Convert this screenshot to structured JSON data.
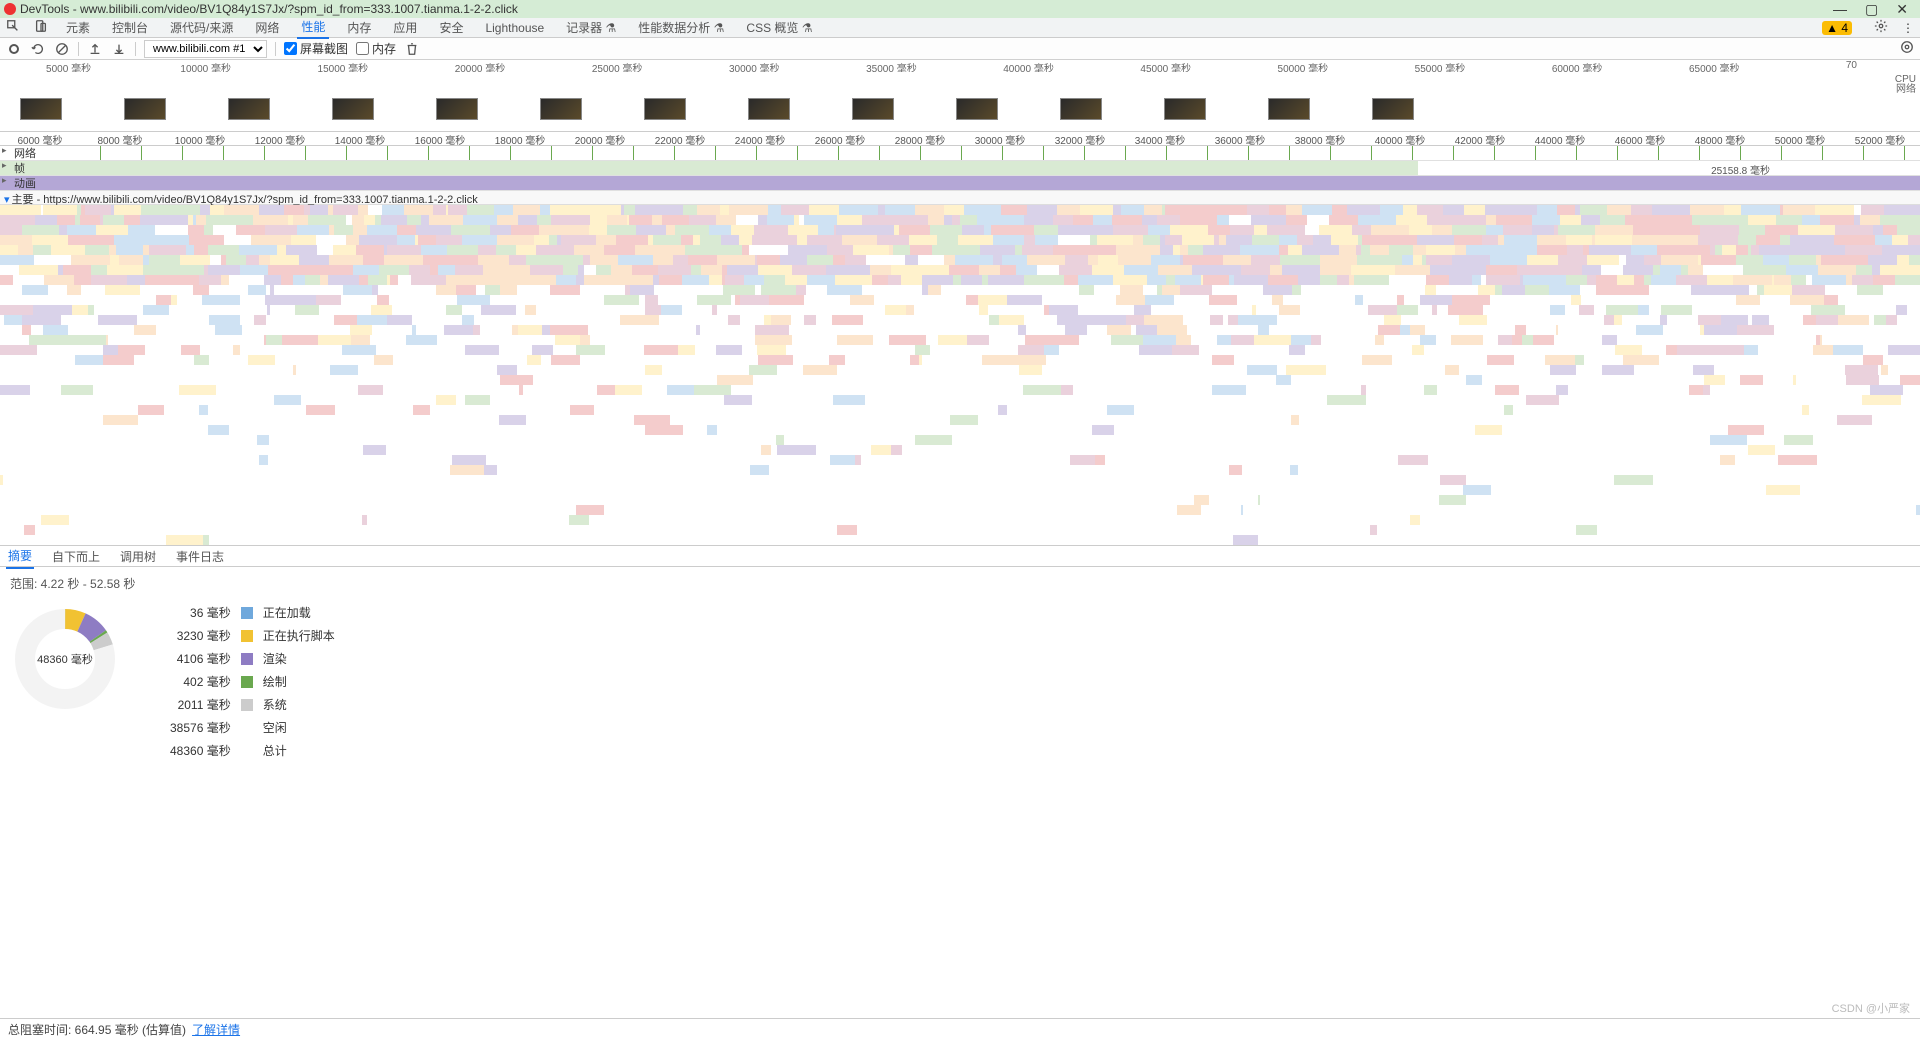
{
  "window": {
    "title": "DevTools - www.bilibili.com/video/BV1Q84y1S7Jx/?spm_id_from=333.1007.tianma.1-2-2.click"
  },
  "tabs": {
    "items": [
      "元素",
      "控制台",
      "源代码/来源",
      "网络",
      "性能",
      "内存",
      "应用",
      "安全",
      "Lighthouse",
      "记录器",
      "性能数据分析",
      "CSS 概览"
    ],
    "active_index": 4,
    "preview_badges": [
      "⚗",
      "⚗",
      "⚗"
    ],
    "warning_count": "4"
  },
  "toolbar": {
    "target": "www.bilibili.com #1",
    "screenshot_label": "屏幕截图",
    "memory_label": "内存",
    "screenshot_checked": true,
    "memory_checked": false
  },
  "overview": {
    "ticks": [
      "5000 毫秒",
      "10000 毫秒",
      "15000 毫秒",
      "20000 毫秒",
      "25000 毫秒",
      "30000 毫秒",
      "35000 毫秒",
      "40000 毫秒",
      "45000 毫秒",
      "50000 毫秒",
      "55000 毫秒",
      "60000 毫秒",
      "65000 毫秒",
      "70"
    ],
    "cpu": "CPU",
    "net": "网络"
  },
  "filmstrip_ticks": [
    "6000 毫秒",
    "8000 毫秒",
    "10000 毫秒",
    "12000 毫秒",
    "14000 毫秒",
    "16000 毫秒",
    "18000 毫秒",
    "20000 毫秒",
    "22000 毫秒",
    "24000 毫秒",
    "26000 毫秒",
    "28000 毫秒",
    "30000 毫秒",
    "32000 毫秒",
    "34000 毫秒",
    "36000 毫秒",
    "38000 毫秒",
    "40000 毫秒",
    "42000 毫秒",
    "44000 毫秒",
    "46000 毫秒",
    "48000 毫秒",
    "50000 毫秒",
    "52000 毫秒"
  ],
  "tracks": {
    "network": "网络",
    "frames": "帧",
    "frames_marker": "25158.8 毫秒",
    "animation": "动画",
    "main": "主要 - https://www.bilibili.com/video/BV1Q84y1S7Jx/?spm_id_from=333.1007.tianma.1-2-2.click"
  },
  "bottom_tabs": {
    "items": [
      "摘要",
      "自下而上",
      "调用树",
      "事件日志"
    ],
    "active_index": 0
  },
  "summary": {
    "range": "范围:  4.22 秒 - 52.58 秒",
    "total_center": "48360 毫秒",
    "rows": [
      {
        "val": "36 毫秒",
        "color": "#6fa8dc",
        "name": "正在加载"
      },
      {
        "val": "3230 毫秒",
        "color": "#f1c232",
        "name": "正在执行脚本"
      },
      {
        "val": "4106 毫秒",
        "color": "#8e7cc3",
        "name": "渲染"
      },
      {
        "val": "402 毫秒",
        "color": "#6aa84f",
        "name": "绘制"
      },
      {
        "val": "2011 毫秒",
        "color": "#cccccc",
        "name": "系统"
      },
      {
        "val": "38576 毫秒",
        "color": "#ffffff",
        "name": "空闲"
      },
      {
        "val": "48360 毫秒",
        "color": "",
        "name": "总计"
      }
    ]
  },
  "status": {
    "text": "总阻塞时间:  664.95 毫秒 (估算值)",
    "link": "了解详情"
  },
  "watermark": "CSDN @小严家",
  "chart_data": {
    "type": "pie",
    "title": "48360 毫秒",
    "series": [
      {
        "name": "正在加载",
        "value": 36,
        "color": "#6fa8dc"
      },
      {
        "name": "正在执行脚本",
        "value": 3230,
        "color": "#f1c232"
      },
      {
        "name": "渲染",
        "value": 4106,
        "color": "#8e7cc3"
      },
      {
        "name": "绘制",
        "value": 402,
        "color": "#6aa84f"
      },
      {
        "name": "系统",
        "value": 2011,
        "color": "#cccccc"
      },
      {
        "name": "空闲",
        "value": 38576,
        "color": "#f3f3f3"
      }
    ],
    "total": 48360
  }
}
